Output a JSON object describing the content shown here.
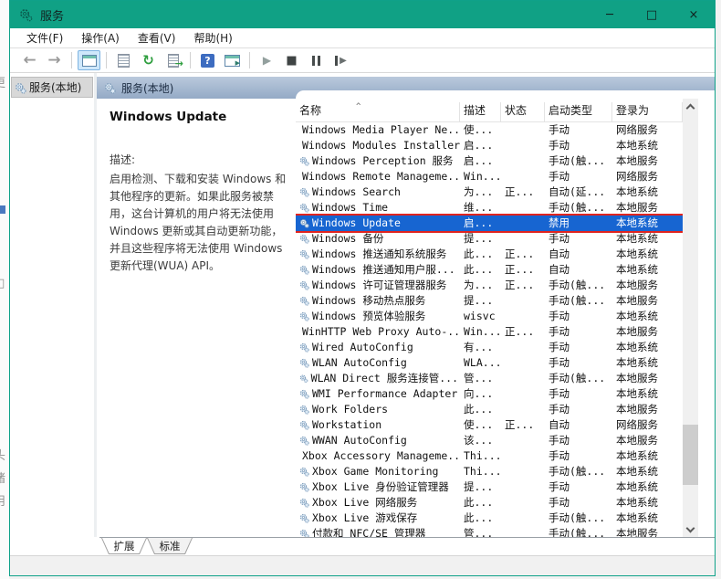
{
  "window": {
    "title": "服务",
    "controls": {
      "minimize": "─",
      "maximize": "□",
      "close": "×"
    }
  },
  "menubar": {
    "items": [
      "文件(F)",
      "操作(A)",
      "查看(V)",
      "帮助(H)"
    ]
  },
  "toolbar": {
    "buttons": [
      "back",
      "forward",
      "separator",
      "console-tree",
      "separator",
      "properties",
      "refresh",
      "export-list",
      "separator",
      "help",
      "action-pane",
      "separator",
      "start-service",
      "stop-service",
      "pause-service",
      "restart-service"
    ]
  },
  "sidebar": {
    "root_label": "服务(本地)"
  },
  "main": {
    "header_title": "服务(本地)",
    "detail": {
      "service_title": "Windows Update",
      "description_label": "描述:",
      "description": "启用检测、下载和安装 Windows 和其他程序的更新。如果此服务被禁用，这台计算机的用户将无法使用 Windows 更新或其自动更新功能，并且这些程序将无法使用 Windows 更新代理(WUA) API。"
    },
    "table": {
      "columns": [
        "名称",
        "描述",
        "状态",
        "启动类型",
        "登录为"
      ],
      "rows": [
        {
          "name": "Windows Media Player Ne...",
          "desc": "使...",
          "status": "",
          "startup": "手动",
          "logon": "网络服务",
          "selected": false
        },
        {
          "name": "Windows Modules Installer",
          "desc": "启...",
          "status": "",
          "startup": "手动",
          "logon": "本地系统",
          "selected": false
        },
        {
          "name": "Windows Perception 服务",
          "desc": "启...",
          "status": "",
          "startup": "手动(触...",
          "logon": "本地服务",
          "selected": false
        },
        {
          "name": "Windows Remote Manageme...",
          "desc": "Win...",
          "status": "",
          "startup": "手动",
          "logon": "网络服务",
          "selected": false
        },
        {
          "name": "Windows Search",
          "desc": "为...",
          "status": "正...",
          "startup": "自动(延...",
          "logon": "本地系统",
          "selected": false
        },
        {
          "name": "Windows Time",
          "desc": "维...",
          "status": "",
          "startup": "手动(触...",
          "logon": "本地服务",
          "selected": false
        },
        {
          "name": "Windows Update",
          "desc": "启...",
          "status": "",
          "startup": "禁用",
          "logon": "本地系统",
          "selected": true
        },
        {
          "name": "Windows 备份",
          "desc": "提...",
          "status": "",
          "startup": "手动",
          "logon": "本地系统",
          "selected": false
        },
        {
          "name": "Windows 推送通知系统服务",
          "desc": "此...",
          "status": "正...",
          "startup": "自动",
          "logon": "本地系统",
          "selected": false
        },
        {
          "name": "Windows 推送通知用户服...",
          "desc": "此...",
          "status": "正...",
          "startup": "自动",
          "logon": "本地系统",
          "selected": false
        },
        {
          "name": "Windows 许可证管理器服务",
          "desc": "为...",
          "status": "正...",
          "startup": "手动(触...",
          "logon": "本地服务",
          "selected": false
        },
        {
          "name": "Windows 移动热点服务",
          "desc": "提...",
          "status": "",
          "startup": "手动(触...",
          "logon": "本地服务",
          "selected": false
        },
        {
          "name": "Windows 预览体验服务",
          "desc": "wisvc",
          "status": "",
          "startup": "手动",
          "logon": "本地系统",
          "selected": false
        },
        {
          "name": "WinHTTP Web Proxy Auto-...",
          "desc": "Win...",
          "status": "正...",
          "startup": "手动",
          "logon": "本地服务",
          "selected": false
        },
        {
          "name": "Wired AutoConfig",
          "desc": "有...",
          "status": "",
          "startup": "手动",
          "logon": "本地系统",
          "selected": false
        },
        {
          "name": "WLAN AutoConfig",
          "desc": "WLA...",
          "status": "",
          "startup": "手动",
          "logon": "本地系统",
          "selected": false
        },
        {
          "name": "WLAN Direct 服务连接管...",
          "desc": "管...",
          "status": "",
          "startup": "手动(触...",
          "logon": "本地服务",
          "selected": false
        },
        {
          "name": "WMI Performance Adapter",
          "desc": "向...",
          "status": "",
          "startup": "手动",
          "logon": "本地系统",
          "selected": false
        },
        {
          "name": "Work Folders",
          "desc": "此...",
          "status": "",
          "startup": "手动",
          "logon": "本地服务",
          "selected": false
        },
        {
          "name": "Workstation",
          "desc": "使...",
          "status": "正...",
          "startup": "自动",
          "logon": "网络服务",
          "selected": false
        },
        {
          "name": "WWAN AutoConfig",
          "desc": "该...",
          "status": "",
          "startup": "手动",
          "logon": "本地服务",
          "selected": false
        },
        {
          "name": "Xbox Accessory Manageme...",
          "desc": "Thi...",
          "status": "",
          "startup": "手动",
          "logon": "本地系统",
          "selected": false
        },
        {
          "name": "Xbox Game Monitoring",
          "desc": "Thi...",
          "status": "",
          "startup": "手动(触...",
          "logon": "本地系统",
          "selected": false
        },
        {
          "name": "Xbox Live 身份验证管理器",
          "desc": "提...",
          "status": "",
          "startup": "手动",
          "logon": "本地系统",
          "selected": false
        },
        {
          "name": "Xbox Live 网络服务",
          "desc": "此...",
          "status": "",
          "startup": "手动",
          "logon": "本地系统",
          "selected": false
        },
        {
          "name": "Xbox Live 游戏保存",
          "desc": "此...",
          "status": "",
          "startup": "手动(触...",
          "logon": "本地系统",
          "selected": false
        },
        {
          "name": "付款和 NFC/SE 管理器",
          "desc": "管...",
          "status": "",
          "startup": "手动(触...",
          "logon": "本地服务",
          "selected": false
        }
      ]
    },
    "tabs": {
      "items": [
        "扩展",
        "标准"
      ],
      "active": "扩展"
    }
  },
  "annotation": {
    "box_color": "#e0241f",
    "target_row": "Windows Update"
  },
  "colors": {
    "titlebar": "#10a185",
    "selection": "#1765d1",
    "band_from": "#bac9dc",
    "band_to": "#94aac6"
  },
  "background_edge": {
    "glyphs": [
      "更",
      "□",
      "头",
      "绪",
      "用"
    ]
  }
}
